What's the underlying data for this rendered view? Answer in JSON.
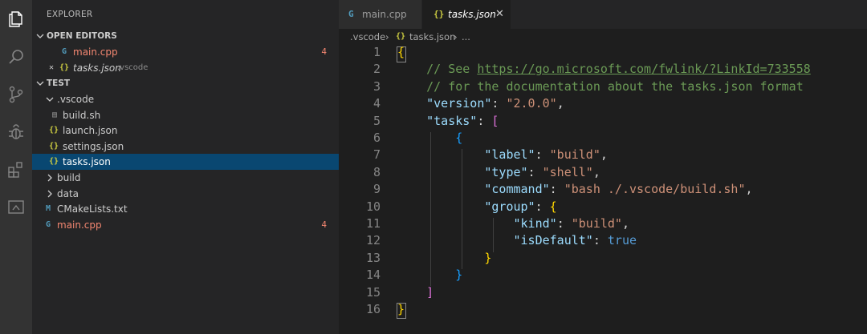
{
  "sidebar": {
    "title": "EXPLORER",
    "open_editors": {
      "header": "OPEN EDITORS",
      "items": [
        {
          "label": "main.cpp",
          "badge": "4"
        },
        {
          "label": "tasks.json",
          "path": ".vscode"
        }
      ]
    },
    "workspace": {
      "header": "TEST",
      "items": [
        {
          "label": ".vscode"
        },
        {
          "label": "build.sh"
        },
        {
          "label": "launch.json"
        },
        {
          "label": "settings.json"
        },
        {
          "label": "tasks.json"
        },
        {
          "label": "build"
        },
        {
          "label": "data"
        },
        {
          "label": "CMakeLists.txt"
        },
        {
          "label": "main.cpp",
          "badge": "4"
        }
      ]
    }
  },
  "tabs": [
    {
      "label": "main.cpp"
    },
    {
      "label": "tasks.json"
    }
  ],
  "breadcrumb": {
    "folder": ".vscode",
    "file": "tasks.json",
    "more": "..."
  },
  "editor": {
    "line_numbers": [
      "1",
      "2",
      "3",
      "4",
      "5",
      "6",
      "7",
      "8",
      "9",
      "10",
      "11",
      "12",
      "13",
      "14",
      "15",
      "16"
    ],
    "comment_see": "// See ",
    "comment_url": "https://go.microsoft.com/fwlink/?LinkId=733558",
    "comment_doc": "// for the documentation about the tasks.json format",
    "key_version": "\"version\"",
    "val_version": "\"2.0.0\"",
    "key_tasks": "\"tasks\"",
    "key_label": "\"label\"",
    "val_label": "\"build\"",
    "key_type": "\"type\"",
    "val_type": "\"shell\"",
    "key_command": "\"command\"",
    "val_command": "\"bash ./.vscode/build.sh\"",
    "key_group": "\"group\"",
    "key_kind": "\"kind\"",
    "val_kind": "\"build\"",
    "key_isdefault": "\"isDefault\"",
    "val_isdefault": "true"
  },
  "colors": {
    "accent": "#094771",
    "comment": "#6a9955",
    "key": "#9cdcfe",
    "string": "#ce9178",
    "error_badge": "#f48771"
  },
  "icons": [
    "files-icon",
    "search-icon",
    "source-control-icon",
    "debug-icon",
    "extensions-icon",
    "remote-explorer-icon"
  ]
}
